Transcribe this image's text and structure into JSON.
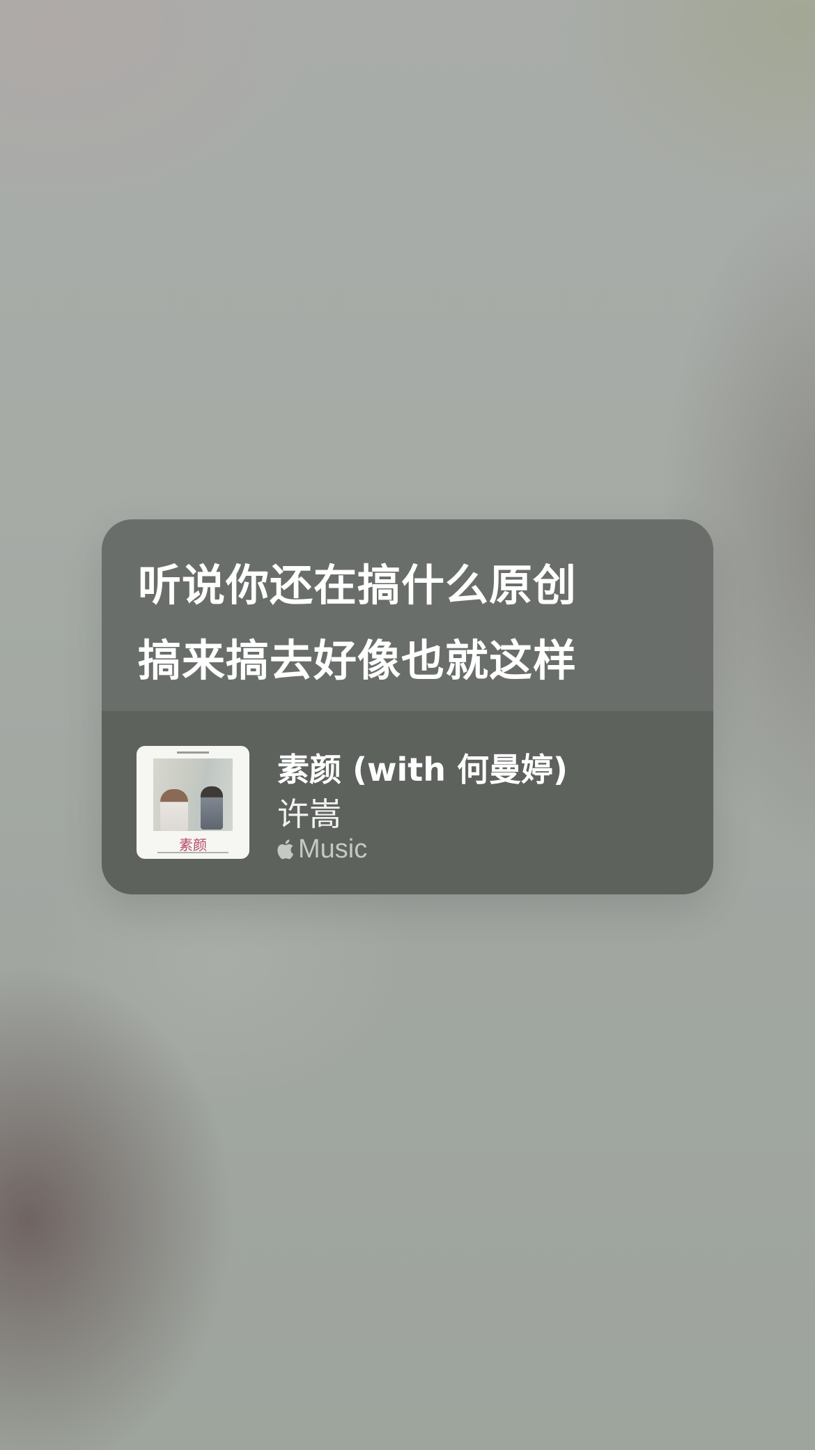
{
  "lyrics": {
    "line1": "听说你还在搞什么原创",
    "line2": "搞来搞去好像也就这样"
  },
  "track": {
    "title": "素颜 (with 何曼婷)",
    "artist": "许嵩",
    "service_label": "Music",
    "service_icon": "apple-logo-icon",
    "artwork_icon": "album-artwork",
    "artwork_title": "素颜"
  }
}
